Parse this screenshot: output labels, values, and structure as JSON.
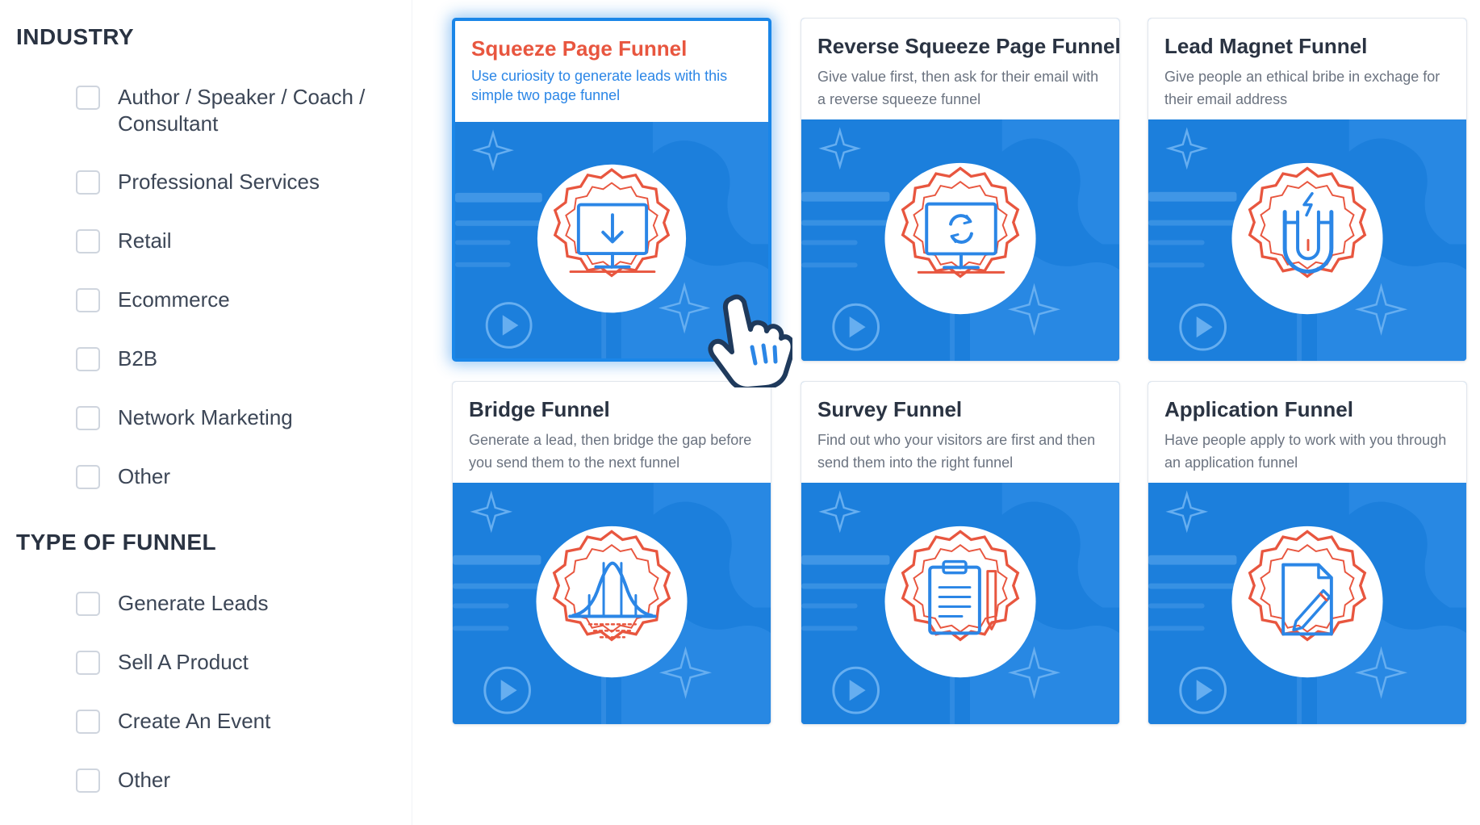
{
  "sidebar": {
    "industry": {
      "title": "INDUSTRY",
      "items": [
        {
          "label": "Author / Speaker / Coach / Consultant"
        },
        {
          "label": "Professional Services"
        },
        {
          "label": "Retail"
        },
        {
          "label": "Ecommerce"
        },
        {
          "label": "B2B"
        },
        {
          "label": "Network Marketing"
        },
        {
          "label": "Other"
        }
      ]
    },
    "funnel_type": {
      "title": "TYPE OF FUNNEL",
      "items": [
        {
          "label": "Generate Leads"
        },
        {
          "label": "Sell A Product"
        },
        {
          "label": "Create An Event"
        },
        {
          "label": "Other"
        }
      ]
    }
  },
  "cards": [
    {
      "title": "Squeeze Page Funnel",
      "description": "Use curiosity to generate leads with this simple two page funnel",
      "icon": "monitor-download-icon",
      "selected": true
    },
    {
      "title": "Reverse Squeeze Page Funnel",
      "description": "Give value first, then ask for their email with a reverse squeeze funnel",
      "icon": "monitor-refresh-icon",
      "selected": false
    },
    {
      "title": "Lead Magnet Funnel",
      "description": "Give people an ethical bribe in exchage for their email address",
      "icon": "magnet-icon",
      "selected": false
    },
    {
      "title": "Bridge Funnel",
      "description": "Generate a lead, then bridge the gap before you send them to the next funnel",
      "icon": "bridge-icon",
      "selected": false
    },
    {
      "title": "Survey Funnel",
      "description": "Find out who your visitors are first and then send them into the right funnel",
      "icon": "clipboard-icon",
      "selected": false
    },
    {
      "title": "Application Funnel",
      "description": "Have people apply to work with you through an application funnel",
      "icon": "document-pen-icon",
      "selected": false
    }
  ],
  "colors": {
    "card_art_blue": "#1c7fdc",
    "selected_title": "#e8563f",
    "selected_desc": "#2b86e6",
    "badge_red": "#e8563f",
    "icon_blue": "#2b86e6"
  }
}
